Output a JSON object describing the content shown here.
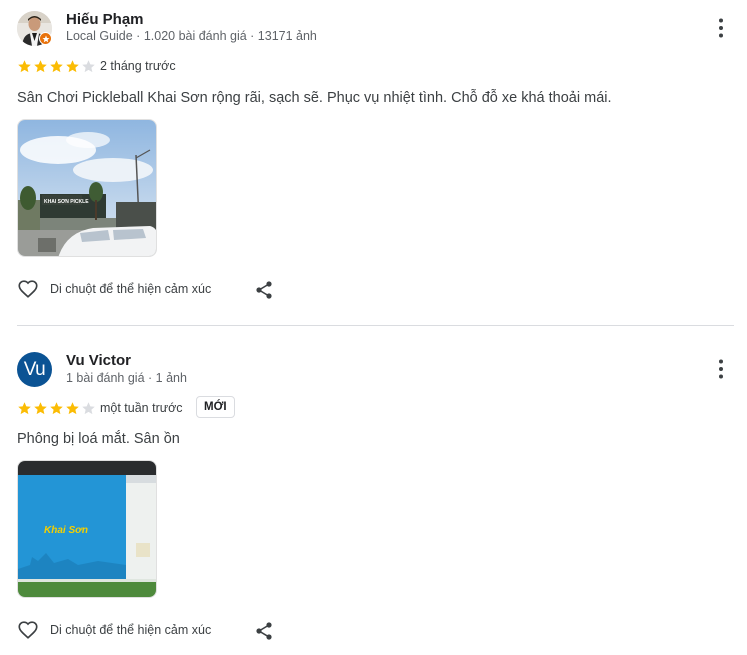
{
  "colors": {
    "star_filled": "#fbbc04",
    "star_empty": "#dadce0",
    "avatar_vu": "#0b5394",
    "local_guide_badge": "#e8710a",
    "divider": "#dadce0"
  },
  "reviews": [
    {
      "author": "Hiếu Phạm",
      "meta": "Local Guide · 1.020 bài đánh giá · 13171 ảnh",
      "rating": 4,
      "time": "2 tháng trước",
      "text": "Sân Chơi Pickleball Khai Sơn rộng rãi, sạch sẽ. Phục vụ nhiệt tình. Chỗ đỗ xe khá thoải mái.",
      "photo_sign": "KHAI SƠN PICKLE",
      "reaction_label": "Di chuột để thể hiện cảm xúc",
      "avatar_type": "photo",
      "local_guide": true
    },
    {
      "author": "Vu Victor",
      "meta": "1 bài đánh giá · 1 ảnh",
      "rating": 4,
      "time": "một tuần trước",
      "new_badge": "MỚI",
      "text": "Phông bị loá mắt. Sân ồn",
      "photo_sign": "Khai Sơn",
      "reaction_label": "Di chuột để thể hiện cảm xúc",
      "avatar_letter": "Vu",
      "avatar_type": "letter"
    }
  ]
}
